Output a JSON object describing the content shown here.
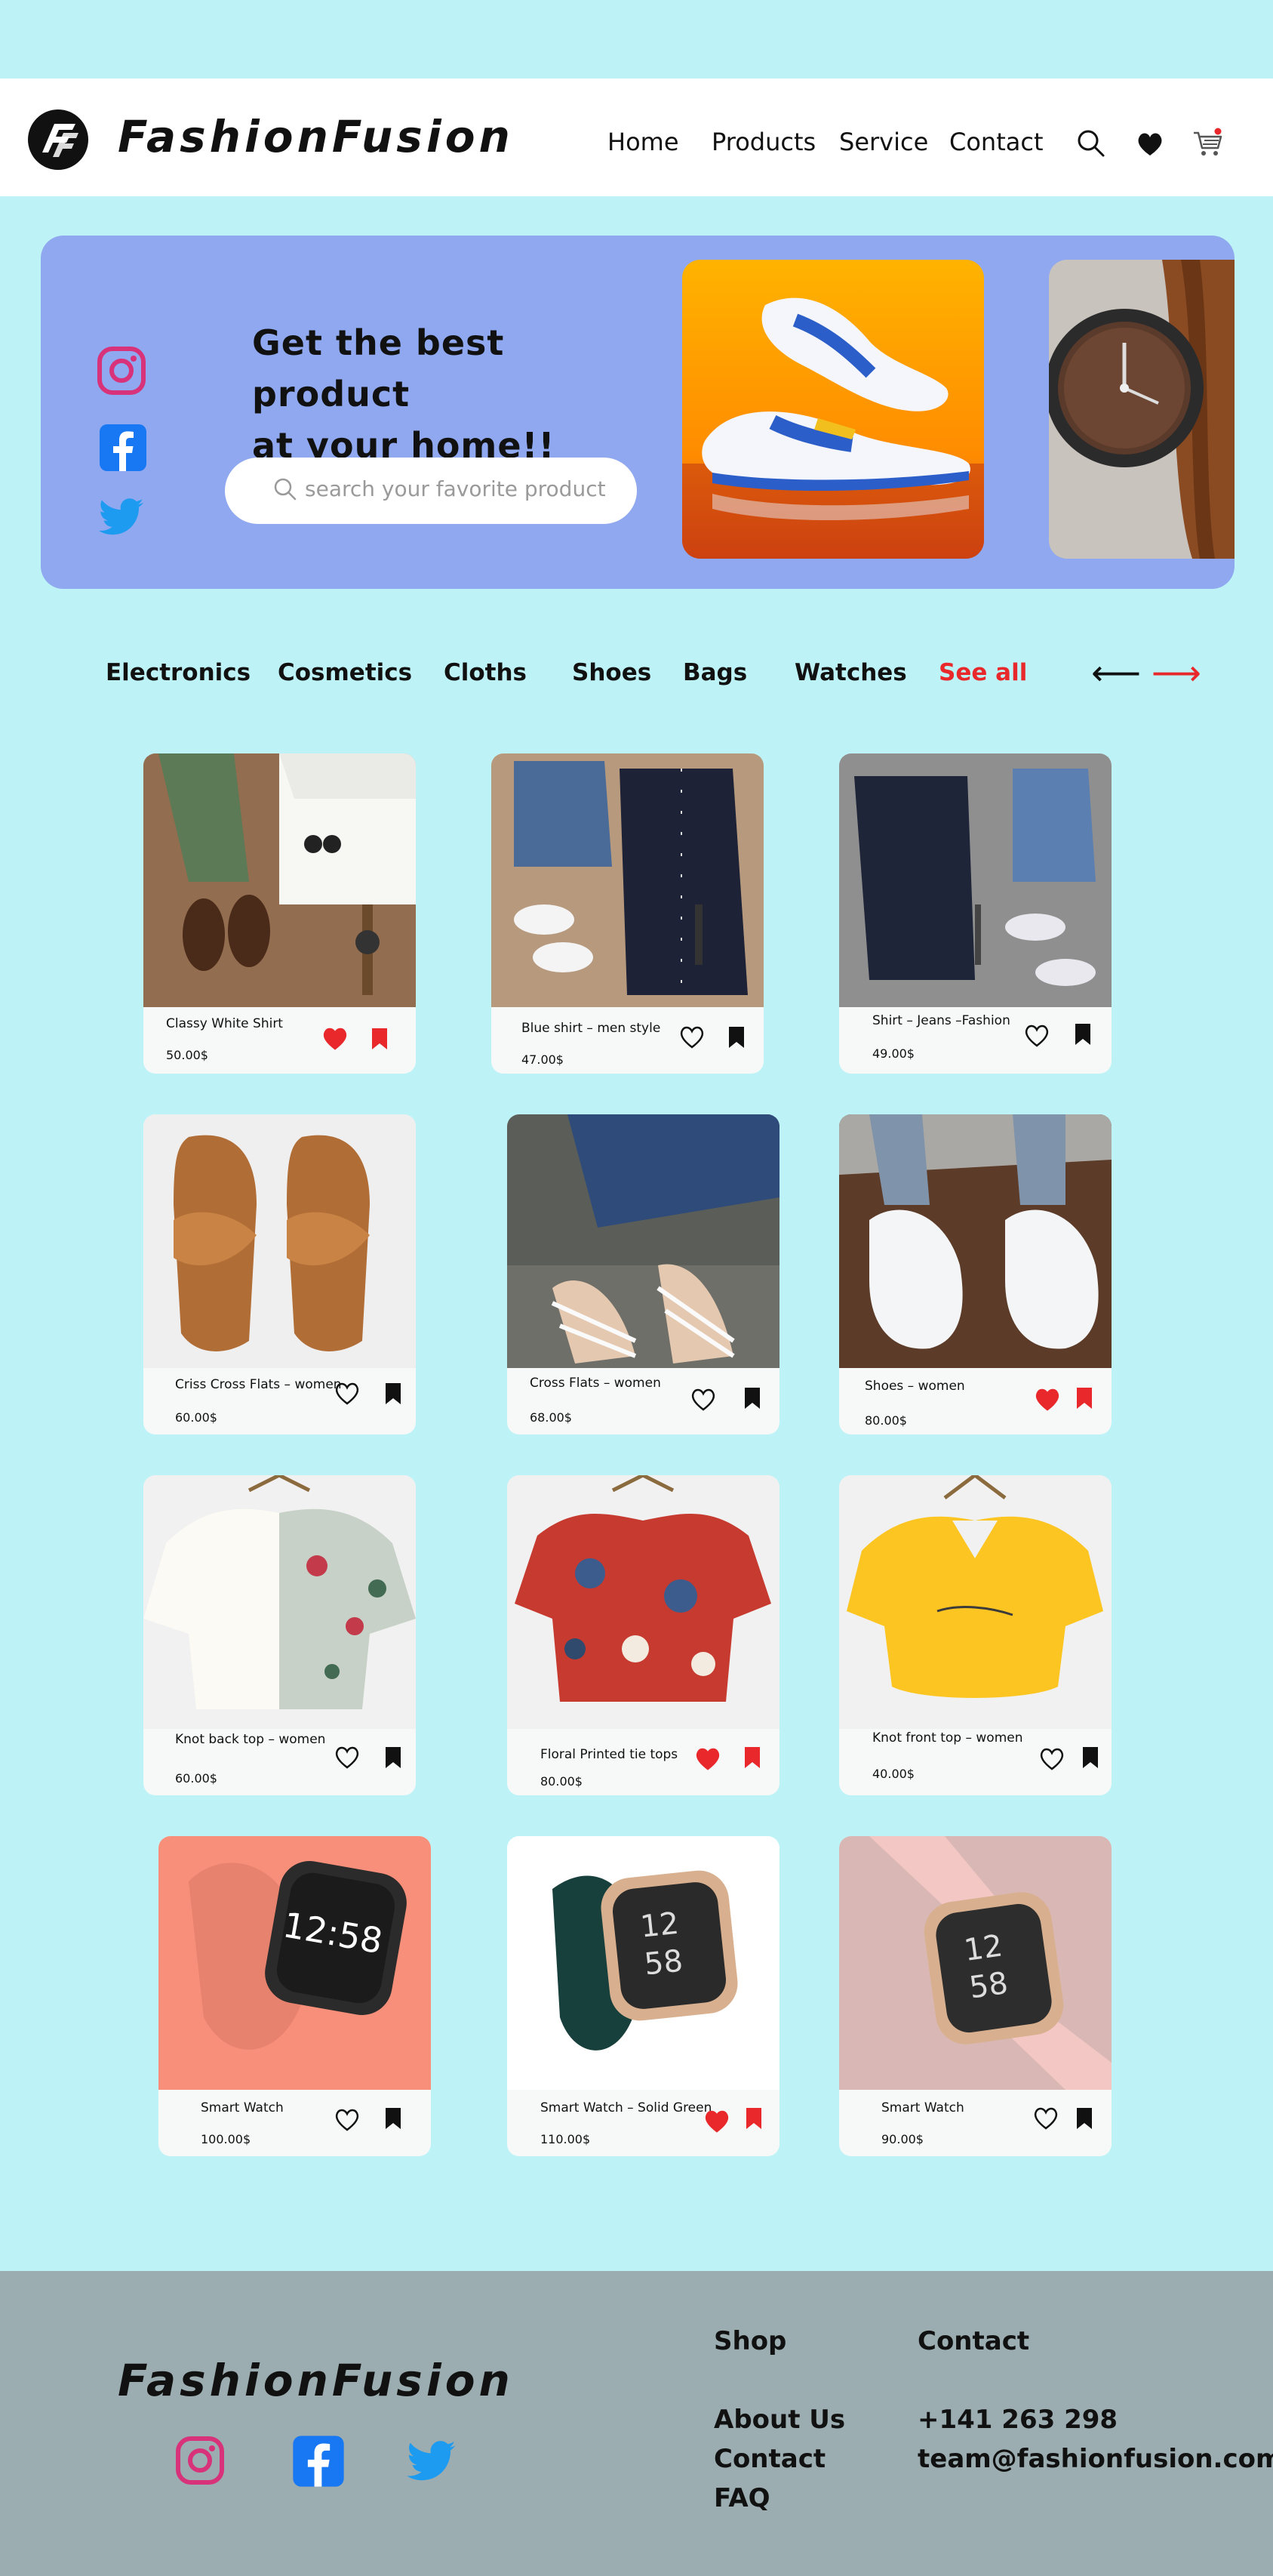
{
  "brand": {
    "name": "FashionFusion",
    "logo_icon": "ff-logo-icon"
  },
  "nav": {
    "items": [
      "Home",
      "Products",
      "Service",
      "Contact"
    ]
  },
  "header_icons": [
    "search-icon",
    "heart-icon",
    "cart-icon"
  ],
  "hero": {
    "heading_line1": "Get the best product",
    "heading_line2": "at your home!!",
    "search_placeholder": "search your favorite product",
    "socials": [
      "instagram-icon",
      "facebook-icon",
      "twitter-icon"
    ]
  },
  "categories": {
    "items": [
      "Electronics",
      "Cosmetics",
      "Cloths",
      "Shoes",
      "Bags",
      "Watches"
    ],
    "see_all": "See all",
    "prev_arrow": "⟵",
    "next_arrow": "⟶"
  },
  "products": [
    {
      "name": "Classy White Shirt",
      "price": "50.00$",
      "liked": true,
      "saved": true
    },
    {
      "name": "Blue shirt – men style",
      "price": "47.00$",
      "liked": false,
      "saved": false
    },
    {
      "name": "Shirt – Jeans –Fashion",
      "price": "49.00$",
      "liked": false,
      "saved": false
    },
    {
      "name": "Criss Cross Flats – women",
      "price": "60.00$",
      "liked": false,
      "saved": false
    },
    {
      "name": "Cross Flats – women",
      "price": "68.00$",
      "liked": false,
      "saved": false
    },
    {
      "name": "Shoes  – women",
      "price": "80.00$",
      "liked": true,
      "saved": true
    },
    {
      "name": "Knot back top – women",
      "price": "60.00$",
      "liked": false,
      "saved": false
    },
    {
      "name": "Floral Printed tie tops",
      "price": "80.00$",
      "liked": true,
      "saved": true
    },
    {
      "name": "Knot front top – women",
      "price": "40.00$",
      "liked": false,
      "saved": false
    },
    {
      "name": "Smart Watch",
      "price": "100.00$",
      "liked": false,
      "saved": false
    },
    {
      "name": "Smart Watch – Solid Green",
      "price": "110.00$",
      "liked": true,
      "saved": true
    },
    {
      "name": "Smart Watch",
      "price": "90.00$",
      "liked": false,
      "saved": false
    }
  ],
  "footer": {
    "shop_heading": "Shop",
    "contact_heading": "Contact",
    "links": [
      "About Us",
      "Contact",
      "FAQ"
    ],
    "phone": "+141 263 298",
    "email": "team@fashionfusion.com"
  },
  "colors": {
    "page_bg": "#bdf3f7",
    "hero_bg": "#8fa8ef",
    "accent_red": "#e8282b",
    "footer_bg": "#9badb0"
  }
}
